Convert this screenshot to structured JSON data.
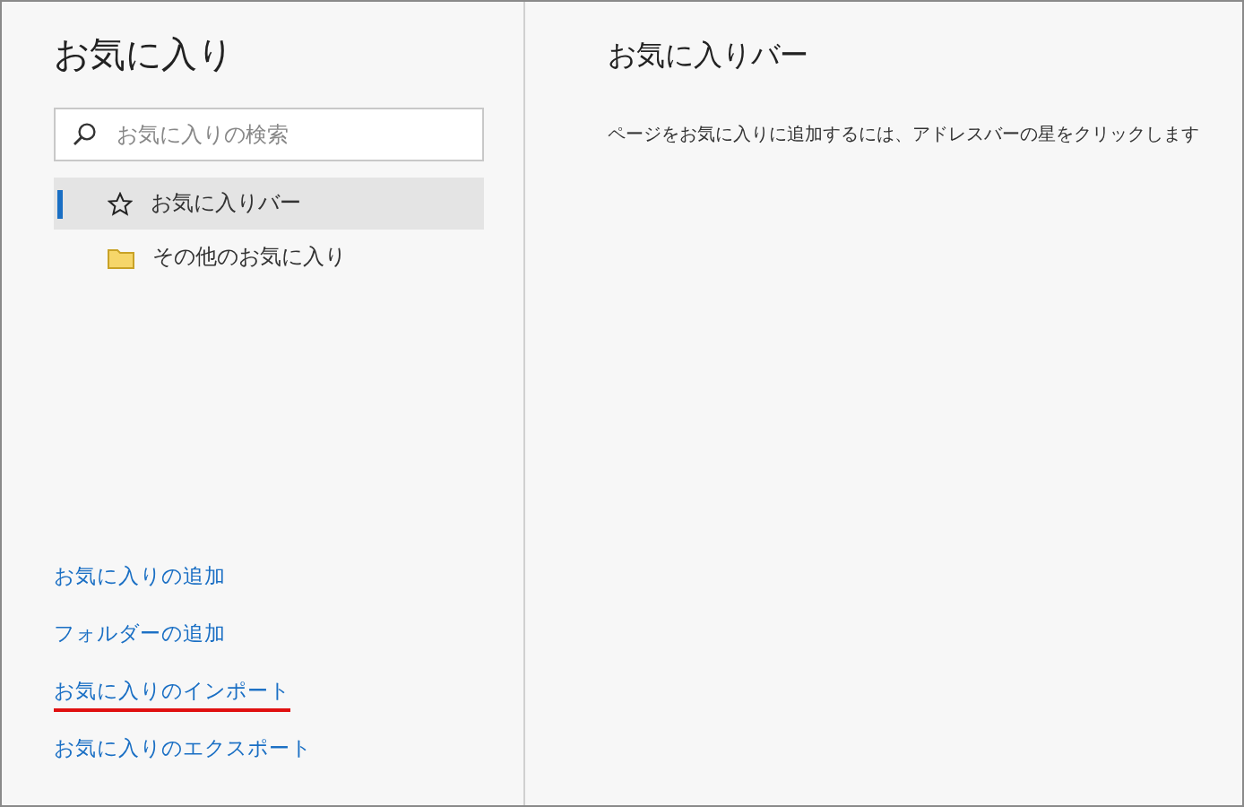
{
  "sidebar": {
    "title": "お気に入り",
    "search": {
      "placeholder": "お気に入りの検索"
    },
    "items": [
      {
        "label": "お気に入りバー",
        "kind": "star",
        "selected": true
      },
      {
        "label": "その他のお気に入り",
        "kind": "folder",
        "selected": false
      }
    ],
    "links": [
      {
        "label": "お気に入りの追加",
        "highlighted": false
      },
      {
        "label": "フォルダーの追加",
        "highlighted": false
      },
      {
        "label": "お気に入りのインポート",
        "highlighted": true
      },
      {
        "label": "お気に入りのエクスポート",
        "highlighted": false
      }
    ]
  },
  "content": {
    "title": "お気に入りバー",
    "message": "ページをお気に入りに追加するには、アドレスバーの星をクリックします"
  }
}
